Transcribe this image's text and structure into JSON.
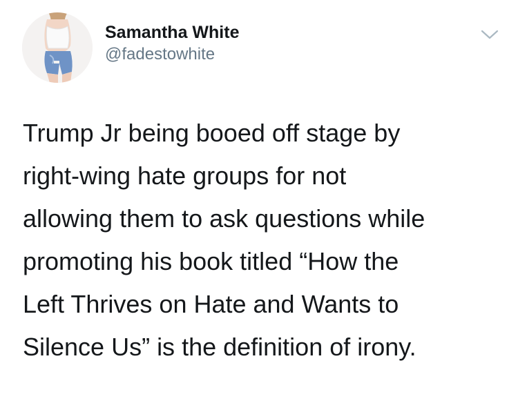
{
  "tweet": {
    "author": {
      "display_name": "Samantha White",
      "handle": "@fadestowhite",
      "avatar_icon": "profile-photo"
    },
    "more_icon": "chevron-down-icon",
    "text_lines": [
      "Trump Jr being booed off stage by",
      "right-wing hate groups for not",
      "allowing them to ask questions while",
      "promoting his book titled “How the",
      "Left Thrives on Hate and Wants to",
      "Silence Us” is the definition of irony."
    ]
  },
  "colors": {
    "text": "#14171a",
    "secondary_text": "#657786",
    "chevron": "#aab8c2",
    "background": "#ffffff"
  }
}
